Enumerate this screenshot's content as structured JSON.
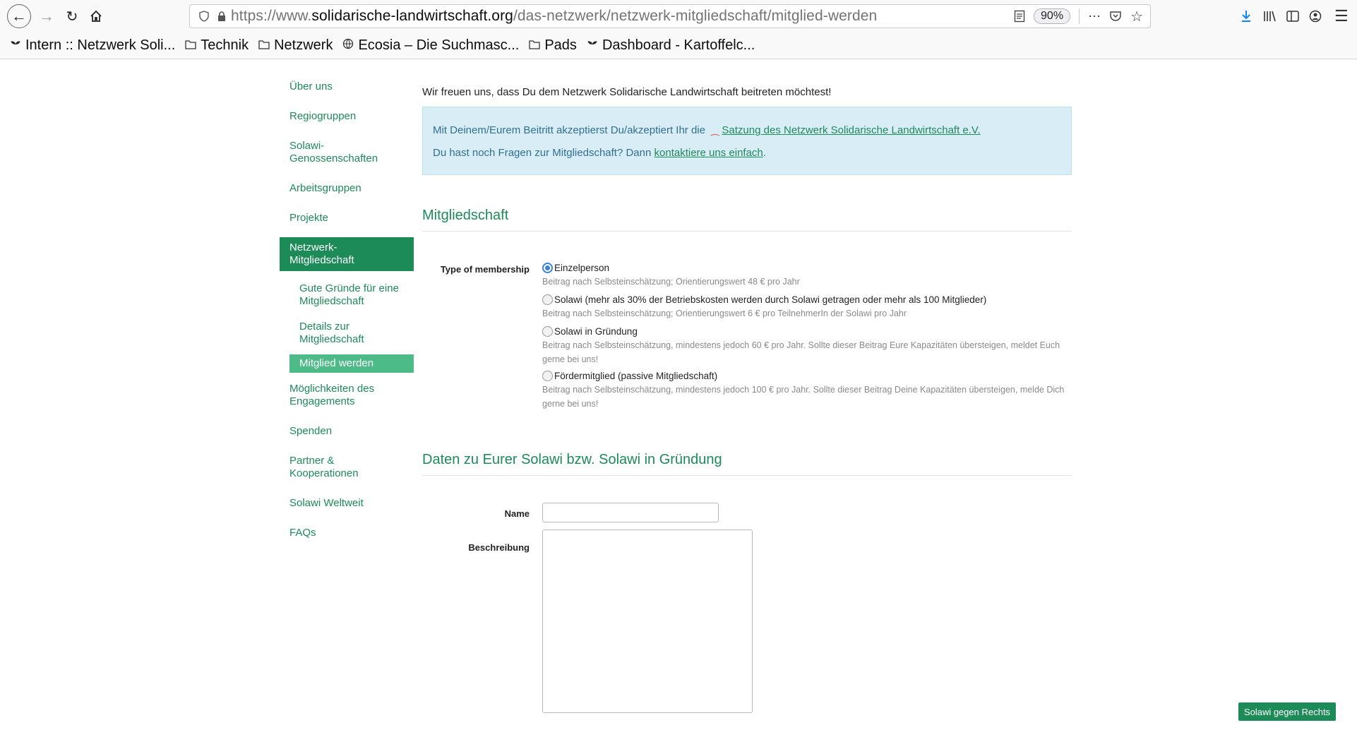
{
  "browser": {
    "url_scheme": "https://www.",
    "url_domain": "solidarische-landwirtschaft.org",
    "url_path": "/das-netzwerk/netzwerk-mitgliedschaft/mitglied-werden",
    "zoom": "90%",
    "bookmarks": [
      {
        "label": "Intern :: Netzwerk Soli...",
        "icon": "sprout-icon"
      },
      {
        "label": "Technik",
        "icon": "folder-icon"
      },
      {
        "label": "Netzwerk",
        "icon": "folder-icon"
      },
      {
        "label": "Ecosia – Die Suchmasc...",
        "icon": "globe-icon"
      },
      {
        "label": "Pads",
        "icon": "folder-icon"
      },
      {
        "label": "Dashboard - Kartoffelc...",
        "icon": "sprout-icon"
      }
    ]
  },
  "sidebar": {
    "items": [
      {
        "label": "Über uns"
      },
      {
        "label": "Regiogruppen"
      },
      {
        "label": "Solawi-\nGenossenschaften"
      },
      {
        "label": "Arbeitsgruppen"
      },
      {
        "label": "Projekte"
      },
      {
        "label": "Netzwerk-\nMitgliedschaft"
      },
      {
        "label": "Gute Gründe für eine\nMitgliedschaft"
      },
      {
        "label": "Details zur\nMitgliedschaft"
      },
      {
        "label": "Mitglied werden"
      },
      {
        "label": "Möglichkeiten des\nEngagements"
      },
      {
        "label": "Spenden"
      },
      {
        "label": "Partner &\nKooperationen"
      },
      {
        "label": "Solawi Weltweit"
      },
      {
        "label": "FAQs"
      }
    ]
  },
  "main": {
    "intro": "Wir freuen uns, dass Du dem Netzwerk Solidarische Landwirtschaft beitreten möchtest!",
    "info_line1_text": "Mit Deinem/Eurem Beitritt akzeptierst Du/akzeptiert Ihr die",
    "info_line1_link": "Satzung des Netzwerk Solidarische Landwirtschaft e.V.",
    "info_line2_text": "Du hast noch Fragen zur Mitgliedschaft? Dann",
    "info_line2_link": "kontaktiere uns einfach",
    "info_line2_end": ".",
    "section1_title": "Mitgliedschaft",
    "membership_label": "Type of membership",
    "options": [
      {
        "label": "Einzelperson",
        "help": "Beitrag nach Selbsteinschätzung; Orientierungswert 48 € pro Jahr",
        "checked": true
      },
      {
        "label": "Solawi (mehr als 30% der Betriebskosten werden durch Solawi getragen oder mehr als 100 Mitglieder)",
        "help": "Beitrag nach Selbsteinschätzung; Orientierungswert 6 € pro TeilnehmerIn der Solawi pro Jahr",
        "checked": false
      },
      {
        "label": "Solawi in Gründung",
        "help": "Beitrag nach Selbsteinschätzung, mindestens jedoch 60 € pro Jahr. Sollte dieser Beitrag Eure Kapazitäten übersteigen, meldet Euch gerne bei uns!",
        "checked": false
      },
      {
        "label": "Fördermitglied (passive Mitgliedschaft)",
        "help": "Beitrag nach Selbsteinschätzung, mindestens jedoch 100 € pro Jahr. Sollte dieser Beitrag Deine Kapazitäten übersteigen, melde Dich gerne bei uns!",
        "checked": false
      }
    ],
    "section2_title": "Daten zu Eurer Solawi bzw. Solawi in Gründung",
    "name_label": "Name",
    "name_value": "",
    "beschreibung_label": "Beschreibung",
    "beschreibung_value": ""
  },
  "floating_button": "Solawi gegen Rechts",
  "colors": {
    "brand_green": "#1c8b58",
    "active_sub_green": "#4dbb88",
    "info_bg": "#d9edf7",
    "info_text": "#31708f"
  }
}
